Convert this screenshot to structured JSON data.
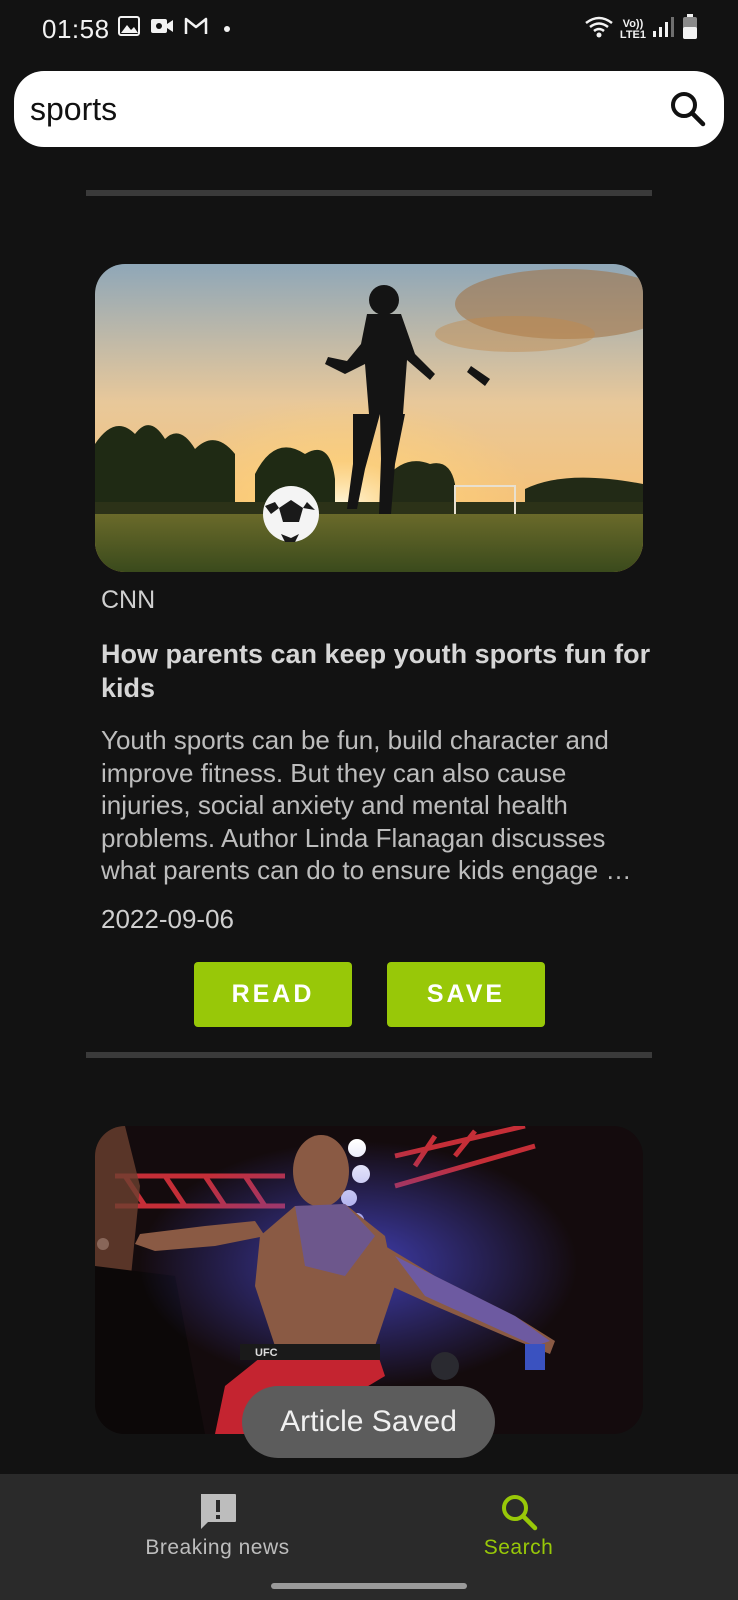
{
  "status_bar": {
    "time": "01:58",
    "network_label": "LTE1",
    "left_icons": [
      "gallery-icon",
      "video-call-icon",
      "gmail-icon",
      "notification-dot"
    ],
    "right_icons": [
      "wifi-icon",
      "volte-icon",
      "signal-icon",
      "battery-icon"
    ]
  },
  "search": {
    "query": "sports",
    "icon": "search-icon"
  },
  "articles": [
    {
      "source": "CNN",
      "title": "How parents can keep youth sports fun for kids",
      "description": "Youth sports can be fun, build character and improve fitness. But they can also cause injuries, social anxiety and mental health problems. Author Linda Flanagan discusses what parents can do to ensure kids engage …",
      "date": "2022-09-06",
      "read_label": "READ",
      "save_label": "SAVE",
      "image": "soccer-sunset-photo"
    },
    {
      "image": "ufc-fighter-photo",
      "image_text": "UFC"
    }
  ],
  "toast": {
    "message": "Article Saved"
  },
  "bottom_nav": {
    "items": [
      {
        "label": "Breaking news",
        "icon": "feedback-icon",
        "active": false
      },
      {
        "label": "Search",
        "icon": "search-icon",
        "active": true
      }
    ]
  },
  "colors": {
    "background": "#121212",
    "accent": "#98c808",
    "nav_background": "#2a2a2a",
    "nav_inactive": "#bdbdbd"
  }
}
